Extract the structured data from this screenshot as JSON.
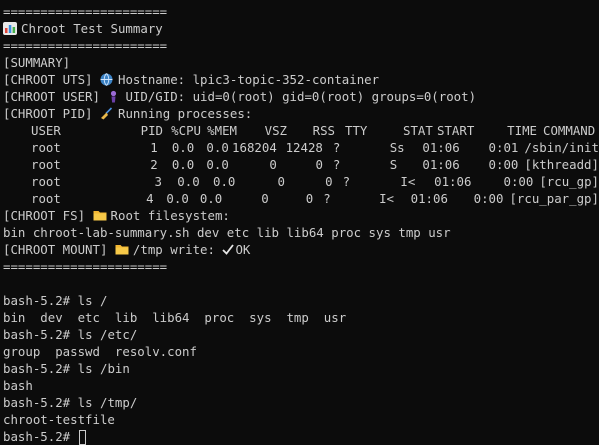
{
  "lines": {
    "sep1": "======================",
    "title": "Chroot Test Summary",
    "sep2": "======================",
    "summary": "[SUMMARY]",
    "uts_tag": "[CHROOT UTS] ",
    "uts_text": "Hostname: lpic3-topic-352-container",
    "user_tag": "[CHROOT USER] ",
    "user_text": "UID/GID: uid=0(root) gid=0(root) groups=0(root)",
    "pid_tag": "[CHROOT PID] ",
    "pid_text": "Running processes:",
    "fs_tag": "[CHROOT FS] ",
    "fs_text": "Root filesystem:",
    "fs_list": "bin chroot-lab-summary.sh dev etc lib lib64 proc sys tmp usr",
    "mount_tag": "[CHROOT MOUNT] ",
    "mount_text": "/tmp write: ",
    "mount_ok": "OK",
    "sep3": "======================"
  },
  "ps": {
    "headers": [
      "USER",
      "PID",
      "%CPU",
      "%MEM",
      "VSZ",
      "RSS",
      "TTY",
      "STAT",
      "START",
      "TIME",
      "COMMAND"
    ],
    "rows": [
      [
        "root",
        "1",
        "0.0",
        "0.0",
        "168204",
        "12428",
        "?",
        "Ss",
        "01:06",
        "0:01",
        "/sbin/init"
      ],
      [
        "root",
        "2",
        "0.0",
        "0.0",
        "0",
        "0",
        "?",
        "S",
        "01:06",
        "0:00",
        "[kthreadd]"
      ],
      [
        "root",
        "3",
        "0.0",
        "0.0",
        "0",
        "0",
        "?",
        "I<",
        "01:06",
        "0:00",
        "[rcu_gp]"
      ],
      [
        "root",
        "4",
        "0.0",
        "0.0",
        "0",
        "0",
        "?",
        "I<",
        "01:06",
        "0:00",
        "[rcu_par_gp]"
      ]
    ]
  },
  "shell": [
    {
      "prompt": "bash-5.2# ",
      "cmd": "ls /"
    },
    {
      "out": "bin  dev  etc  lib  lib64  proc  sys  tmp  usr"
    },
    {
      "prompt": "bash-5.2# ",
      "cmd": "ls /etc/"
    },
    {
      "out": "group  passwd  resolv.conf"
    },
    {
      "prompt": "bash-5.2# ",
      "cmd": "ls /bin"
    },
    {
      "out": "bash"
    },
    {
      "prompt": "bash-5.2# ",
      "cmd": "ls /tmp/"
    },
    {
      "out": "chroot-testfile"
    }
  ],
  "current_prompt": "bash-5.2# ",
  "icons": {
    "title": "bar-chart-icon",
    "uts": "globe-icon",
    "user": "person-icon",
    "pid": "broom-icon",
    "fs": "folder-icon",
    "mount": "folder-icon",
    "check": "checkmark-icon"
  }
}
